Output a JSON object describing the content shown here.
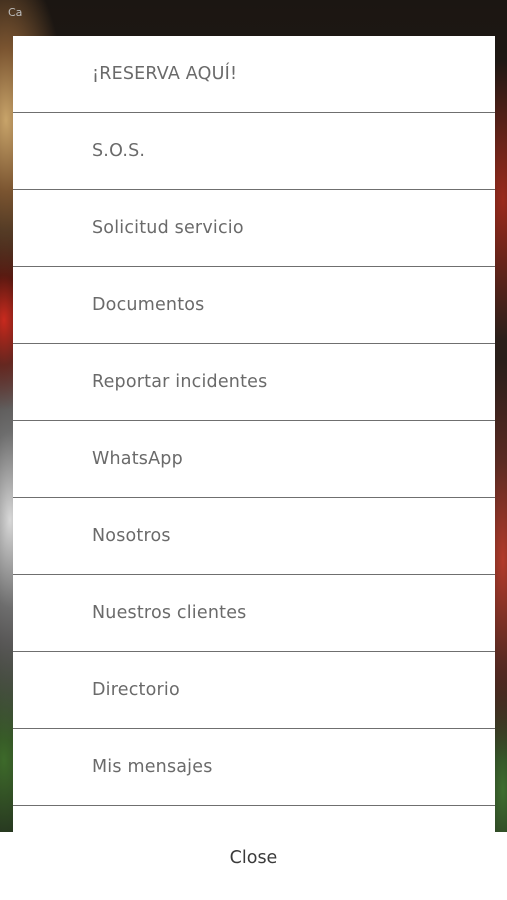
{
  "status_bar": {
    "text": "Ca"
  },
  "menu": {
    "items": [
      {
        "label": "¡RESERVA AQUÍ!"
      },
      {
        "label": "S.O.S."
      },
      {
        "label": "Solicitud servicio"
      },
      {
        "label": "Documentos"
      },
      {
        "label": "Reportar incidentes"
      },
      {
        "label": "WhatsApp"
      },
      {
        "label": "Nosotros"
      },
      {
        "label": "Nuestros clientes"
      },
      {
        "label": "Directorio"
      },
      {
        "label": "Mis mensajes"
      },
      {
        "label": ""
      }
    ]
  },
  "footer": {
    "close_label": "Close"
  },
  "colors": {
    "menu_background": "#ffffff",
    "divider": "#6f6f6f",
    "menu_text": "#6a6a6a",
    "close_text": "#3a3a3a"
  }
}
